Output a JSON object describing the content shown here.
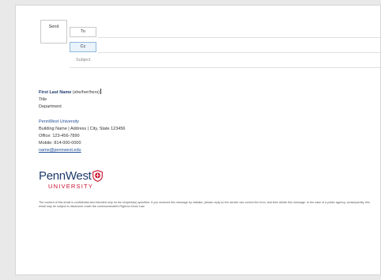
{
  "compose": {
    "send_label": "Send",
    "to_label": "To",
    "cc_label": "Cc",
    "subject_label": "Subject"
  },
  "signature": {
    "name": "First Last Name",
    "pronouns": "(she/her/hers)",
    "title": "Title",
    "department": "Department",
    "university": "PennWest University",
    "address": "Building Name | Address | City, State 123456",
    "office": "Office: 123-456-7890",
    "mobile": "Mobile: 814-000-0000",
    "email": "name@pennwest.edu"
  },
  "logo": {
    "wordmark": "PennWest",
    "subtitle": "UNIVERSITY",
    "primary_color": "#1f3a6e",
    "accent_color": "#c8102e"
  },
  "disclaimer": "The content of this email is confidential and intended only for the recipient(s) specified. If you received this message by mistake, please reply so the sender can correct the error, and then delete this message. In the case of a public agency, consequently, this email may be subject to disclosure under the commonwealth's Right-to-Know Law."
}
